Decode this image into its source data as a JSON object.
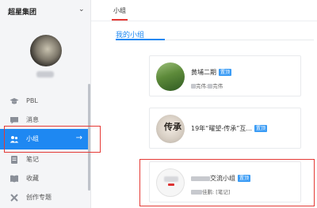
{
  "org": {
    "name": "超星集团",
    "icons": {
      "chevron": "chevron-down-icon"
    }
  },
  "sidebar": {
    "items": [
      {
        "label": "PBL",
        "icon": "graduation-cap-icon",
        "active": false
      },
      {
        "label": "消息",
        "icon": "chat-bubble-icon",
        "active": false
      },
      {
        "label": "小组",
        "icon": "group-icon",
        "active": true
      },
      {
        "label": "笔记",
        "icon": "note-icon",
        "active": false
      },
      {
        "label": "收藏",
        "icon": "book-icon",
        "active": false
      },
      {
        "label": "创作专题",
        "icon": "tools-icon",
        "active": false
      }
    ],
    "active_arrow": "→"
  },
  "header": {
    "tab": "小组"
  },
  "subtabs": {
    "active": "我的小组"
  },
  "groups": [
    {
      "title": "黄埔二期",
      "badge": "置顶",
      "sub_prefix": "",
      "sub_mid": "完伟:",
      "sub_suffix": "完伟"
    },
    {
      "title": "19年“曜望-传承”互...",
      "badge": "置顶",
      "callig": "传承"
    },
    {
      "title": "交流小组",
      "badge": "置顶",
      "sub_prefix": "",
      "sub_mid": "佳鹏:",
      "sub_suffix": "[笔记]"
    }
  ],
  "colors": {
    "accent": "#1e88f2",
    "highlight": "#e53935",
    "badge": "#3b9cf5"
  }
}
